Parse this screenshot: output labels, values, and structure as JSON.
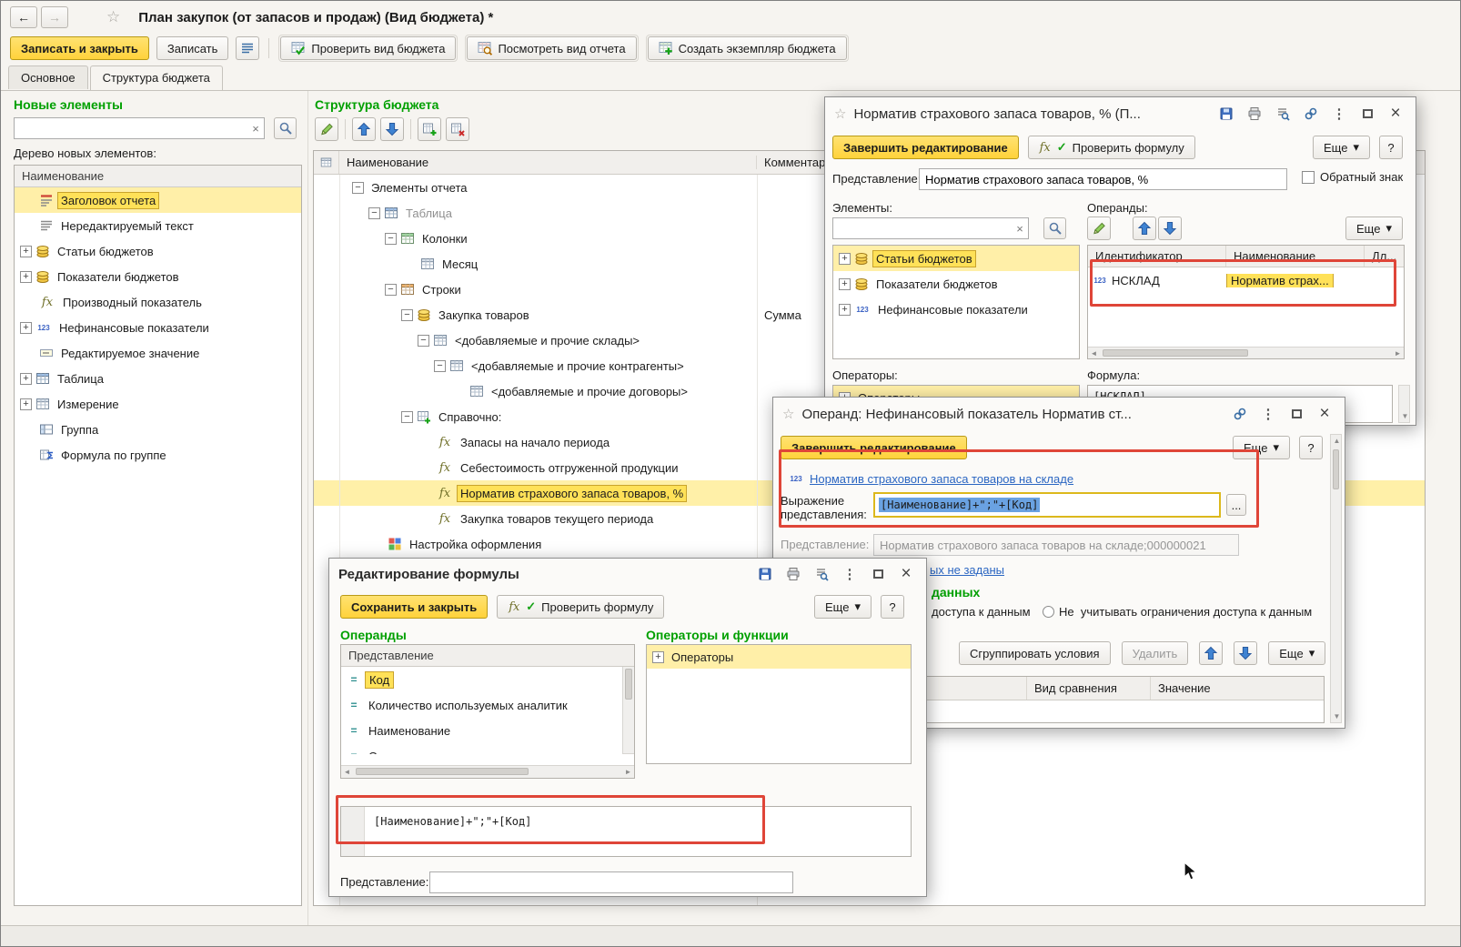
{
  "glyphs": {
    "back": "←",
    "forward": "→",
    "star": "☆",
    "close": "×",
    "dots": "⋮",
    "dropdown": "▾",
    "clear": "×",
    "plus": "+",
    "minus": "−",
    "fx": "fx",
    "num": "123",
    "eq": "=",
    "check": "✓",
    "scroll_up": "▲",
    "scroll_down": "▼",
    "scroll_left": "◄",
    "scroll_right": "►"
  },
  "window": {
    "title": "План закупок (от запасов и продаж) (Вид бюджета) *",
    "toolbar": {
      "save_and_close": "Записать и закрыть",
      "save": "Записать",
      "check_view": "Проверить вид бюджета",
      "preview_report": "Посмотреть вид отчета",
      "create_instance": "Создать экземпляр бюджета"
    },
    "tabs": {
      "main": "Основное",
      "structure": "Структура бюджета"
    }
  },
  "left_panel": {
    "title": "Новые элементы",
    "tree_caption": "Дерево новых элементов:",
    "column_header": "Наименование",
    "items": [
      "Заголовок отчета",
      "Нередактируемый текст",
      "Статьи бюджетов",
      "Показатели бюджетов",
      "Производный показатель",
      "Нефинансовые показатели",
      "Редактируемое значение",
      "Таблица",
      "Измерение",
      "Группа",
      "Формула по группе"
    ]
  },
  "structure": {
    "title": "Структура бюджета",
    "columns": {
      "name": "Наименование",
      "comment": "Комментар"
    },
    "rows": [
      {
        "label": "Элементы отчета"
      },
      {
        "label": "Таблица"
      },
      {
        "label": "Колонки"
      },
      {
        "label": "Месяц"
      },
      {
        "label": "Строки"
      },
      {
        "label": "Закупка товаров",
        "comment": "Сумма"
      },
      {
        "label": "<добавляемые и прочие склады>"
      },
      {
        "label": "<добавляемые и прочие контрагенты>"
      },
      {
        "label": "<добавляемые и прочие договоры>"
      },
      {
        "label": "Справочно:"
      },
      {
        "label": "Запасы на начало периода"
      },
      {
        "label": "Себестоимость отгруженной продукции"
      },
      {
        "label": "Норматив страхового запаса товаров, %"
      },
      {
        "label": "Закупка товаров текущего периода"
      },
      {
        "label": "Настройка оформления"
      }
    ]
  },
  "indicator_dialog": {
    "title": "Норматив страхового запаса товаров, % (П...",
    "finish_button": "Завершить редактирование",
    "check_formula_button": "Проверить формулу",
    "more_button": "Еще",
    "help_button": "?",
    "presentation_label": "Представление:",
    "presentation_value": "Норматив страхового запаса товаров, %",
    "inverse_sign_label": "Обратный знак",
    "elements_label": "Элементы:",
    "operands_label": "Операнды:",
    "element_items": [
      "Статьи бюджетов",
      "Показатели бюджетов",
      "Нефинансовые показатели"
    ],
    "operand_columns": {
      "id": "Идентификатор",
      "name": "Наименование",
      "len": "Дл..."
    },
    "operand_row": {
      "id": "НСКЛАД",
      "name": "Норматив страх..."
    },
    "operators_label": "Операторы:",
    "operators_item": "Операторы",
    "formula_label": "Формула:",
    "formula_value": "[НСКЛАД]"
  },
  "operand_dialog": {
    "title": "Операнд: Нефинансовый показатель Норматив ст...",
    "finish_button": "Завершить редактирование",
    "more_button": "Еще",
    "help_button": "?",
    "indicator_link": "Норматив страхового запаса товаров на складе",
    "expression_label": "Выражение представления:",
    "expression_value": "[Наименование]+\";\"+[Код]",
    "choose_button": "...",
    "presentation_label": "Представление:",
    "presentation_value": "Норматив страхового запаса товаров на складе;000000021",
    "fields_link_fragment": "ых не заданы",
    "access_title_fragment": "данных",
    "access_option_fragment": "доступа к данным",
    "access_option_ignore": "Не  учитывать ограничения доступа к данным",
    "group_conditions_button": "Сгруппировать условия",
    "delete_button": "Удалить",
    "grid_columns": {
      "kind": "Вид сравнения",
      "value": "Значение"
    }
  },
  "formula_dialog": {
    "title": "Редактирование формулы",
    "save_button": "Сохранить и закрыть",
    "check_formula_button": "Проверить формулу",
    "more_button": "Еще",
    "help_button": "?",
    "operands_title": "Операнды",
    "operators_title": "Операторы и функции",
    "operands_header": "Представление",
    "operand_items": [
      "Код",
      "Количество используемых аналитик",
      "Наименование",
      "Описание"
    ],
    "operators_item": "Операторы",
    "formula_text": "[Наименование]+\";\"+[Код]",
    "presentation_label": "Представление:"
  }
}
